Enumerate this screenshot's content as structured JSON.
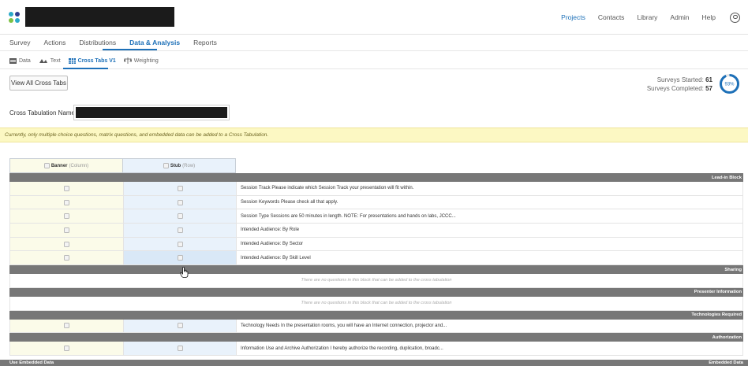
{
  "colors": {
    "accent": "#1d70b8",
    "notice_bg": "#fcf8c3",
    "block_bar": "#777777",
    "banner_col": "#fbfbe9",
    "stub_col": "#e9f2fb"
  },
  "topnav": {
    "links": [
      {
        "label": "Projects",
        "active": true
      },
      {
        "label": "Contacts"
      },
      {
        "label": "Library"
      },
      {
        "label": "Admin"
      },
      {
        "label": "Help"
      }
    ],
    "user_icon": "user-circle-icon"
  },
  "tabs": [
    "Survey",
    "Actions",
    "Distributions",
    "Data & Analysis",
    "Reports"
  ],
  "active_tab": "Data & Analysis",
  "subtabs": [
    {
      "label": "Data",
      "icon": "table-icon"
    },
    {
      "label": "Text",
      "icon": "text-icon"
    },
    {
      "label": "Cross Tabs V1",
      "icon": "grid-icon",
      "active": true
    },
    {
      "label": "Weighting",
      "icon": "scale-icon"
    }
  ],
  "view_all_button": "View All Cross Tabs",
  "stats": {
    "started_label": "Surveys Started:",
    "started_value": "61",
    "completed_label": "Surveys Completed:",
    "completed_value": "57",
    "percent_label": "93%",
    "percent": 93
  },
  "crosstab_name_label": "Cross Tabulation Name:",
  "notice": "Currently, only multiple choice questions, matrix questions, and embedded data can be added to a Cross Tabulation.",
  "grid": {
    "banner_header": "Banner",
    "banner_sub": "(Column)",
    "stub_header": "Stub",
    "stub_sub": "(Row)",
    "blocks": [
      {
        "name": "Lead-in Block",
        "questions": [
          "Session Track Please indicate which Session Track your presentation will fit within.",
          "Session Keywords Please check all that apply.",
          "Session Type Sessions are 50 minutes in length.  NOTE: For presentations and hands on labs, JCCC...",
          "Intended Audience:  By Role",
          "Intended Audience:  By Sector",
          "Intended Audience:  By Skill Level"
        ]
      },
      {
        "name": "Sharing",
        "empty": "There are no questions in this block that can be added to the cross tabulation"
      },
      {
        "name": "Presenter Information",
        "empty": "There are no questions in this block that can be added to the cross tabulation"
      },
      {
        "name": "Technologies Required",
        "questions": [
          "Technology Needs  In the presentation rooms, you will have an Internet connection, projector and..."
        ]
      },
      {
        "name": "Authorization",
        "questions": [
          "Information Use and Archive Authorization  I hereby authorize the recording, duplication, broadc..."
        ]
      }
    ]
  },
  "bottom_bar": {
    "left": "Use Embedded Data",
    "right": "Embedded Data"
  }
}
